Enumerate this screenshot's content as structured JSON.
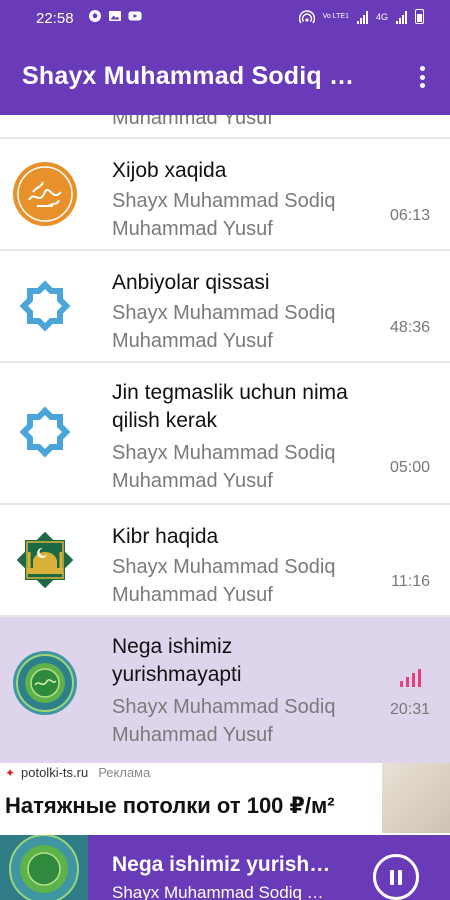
{
  "status_bar": {
    "time": "22:58",
    "notification_icons": [
      "soccer-ball-icon",
      "image-icon",
      "youtube-icon"
    ],
    "right_icons": [
      "hotspot-icon",
      "volte-icon",
      "signal-icon",
      "signal-icon",
      "battery-icon"
    ]
  },
  "app_bar": {
    "title": "Shayx Muhammad Sodiq Muhammad Yusuf",
    "menu_icon": "more-vertical-icon",
    "color": "#6a3bb8"
  },
  "list": {
    "partial_top_subtitle": "Muhammad Yusuf",
    "items": [
      {
        "title": "Xijob xaqida",
        "author": "Shayx Muhammad Sodiq Muhammad Yusuf",
        "duration": "06:13",
        "thumb": "orange-calligraphy-medallion",
        "active": false
      },
      {
        "title": "Anbiyolar qissasi",
        "author": "Shayx Muhammad Sodiq Muhammad Yusuf",
        "duration": "48:36",
        "thumb": "blue-octagram-icon",
        "active": false
      },
      {
        "title": "Jin tegmaslik uchun nima qilish kerak",
        "author": "Shayx Muhammad Sodiq Muhammad Yusuf",
        "duration": "05:00",
        "thumb": "blue-octagram-icon",
        "active": false
      },
      {
        "title": "Kibr haqida",
        "author": "Shayx Muhammad Sodiq Muhammad Yusuf",
        "duration": "11:16",
        "thumb": "green-gold-mosque-icon",
        "active": false
      },
      {
        "title": "Nega ishimiz yurishmayapti",
        "author": "Shayx Muhammad Sodiq Muhammad Yusuf",
        "duration": "20:31",
        "thumb": "teal-ornament-medallion",
        "active": true
      }
    ]
  },
  "ad": {
    "source": "potolki-ts.ru",
    "label": "Реклама",
    "headline": "Натяжные потолки от 100 ₽/м²"
  },
  "player": {
    "title": "Nega ishimiz yurishmayapti",
    "author": "Shayx Muhammad Sodiq Muhammad Yusuf",
    "control_icon": "pause-icon",
    "color": "#6a3bb8"
  },
  "colors": {
    "accent": "#6a3bb8",
    "active_row": "#ded4ec",
    "equalizer": "#e8407a"
  }
}
